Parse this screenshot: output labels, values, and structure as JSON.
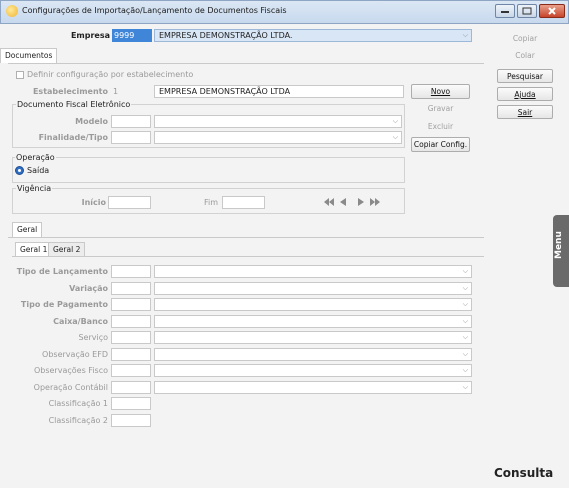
{
  "window": {
    "title": "Configurações de Importação/Lançamento de Documentos Fiscais"
  },
  "empresa": {
    "label": "Empresa",
    "code": "9999",
    "name": "EMPRESA DEMONSTRAÇÃO LTDA."
  },
  "tabs_top": [
    "Documentos"
  ],
  "documentos": {
    "definir_config_label": "Definir configuração por estabelecimento",
    "estabelecimento_label": "Estabelecimento",
    "estabelecimento_code": "1",
    "estabelecimento_name": "EMPRESA DEMONSTRAÇÃO LTDA",
    "doc_fiscal_title": "Documento Fiscal Eletrônico",
    "modelo_label": "Modelo",
    "finalidade_label": "Finalidade/Tipo",
    "operacao_title": "Operação",
    "operacao_option": "Saída",
    "vigencia_title": "Vigência",
    "inicio_label": "Início",
    "fim_label": "Fim"
  },
  "doc_buttons": {
    "novo": "Novo",
    "gravar": "Gravar",
    "excluir": "Excluir",
    "copiar_config": "Copiar Config."
  },
  "right_buttons": {
    "copiar": "Copiar",
    "colar": "Colar",
    "pesquisar": "Pesquisar",
    "ajuda": "Ajuda",
    "sair": "Sair"
  },
  "side_tab": "Menu",
  "consulta": "Consulta",
  "geral": {
    "tab": "Geral",
    "subtabs": [
      "Geral 1",
      "Geral 2"
    ],
    "fields": [
      {
        "label": "Tipo de Lançamento",
        "bold": true,
        "combo": true
      },
      {
        "label": "Variação",
        "bold": true,
        "combo": true
      },
      {
        "label": "Tipo de Pagamento",
        "bold": true,
        "combo": true
      },
      {
        "label": "Caixa/Banco",
        "bold": true,
        "combo": true
      },
      {
        "label": "Serviço",
        "bold": false,
        "combo": true
      },
      {
        "label": "Observação EFD",
        "bold": false,
        "combo": true
      },
      {
        "label": "Observações Fisco",
        "bold": false,
        "combo": true
      },
      {
        "label": "Operação Contábil",
        "bold": false,
        "combo": true
      },
      {
        "label": "Classificação 1",
        "bold": false,
        "combo": false
      },
      {
        "label": "Classificação 2",
        "bold": false,
        "combo": false
      }
    ]
  }
}
